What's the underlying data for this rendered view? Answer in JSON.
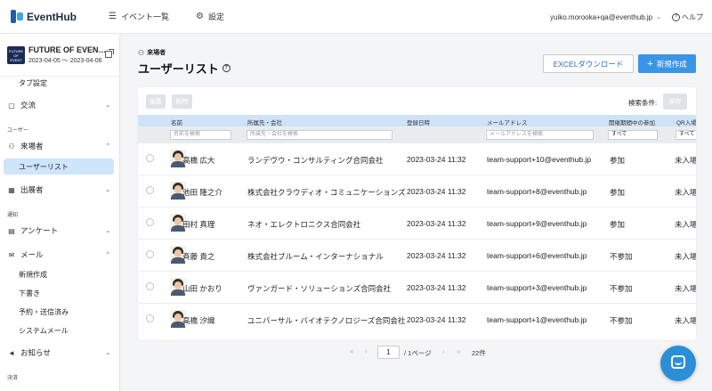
{
  "app": {
    "logo_text": "EventHub",
    "colors": {
      "accent": "#3b95e6",
      "header_row": "#cfe3f8",
      "active_nav": "#cfe5fb"
    }
  },
  "topnav": {
    "events_icon": "list-icon",
    "events_label": "イベント一覧",
    "settings_icon": "gear-icon",
    "settings_label": "設定",
    "user_email": "yuiko.morooka+qa@eventhub.jp",
    "help_label": "ヘルプ"
  },
  "sidebar": {
    "event": {
      "thumb_text": "FUTURE OF EVENT",
      "title": "FUTURE OF EVEN…",
      "dates": "2023-04-05 〜 2023-04-06"
    },
    "tab_settings": "タブ設定",
    "interaction": "交流",
    "group_user": "ユーザー",
    "attendees": "来場者",
    "user_list": "ユーザーリスト",
    "exhibitors": "出展者",
    "group_notify": "通知",
    "survey": "アンケート",
    "mail": "メール",
    "mail_new": "新規作成",
    "mail_draft": "下書き",
    "mail_scheduled": "予約・送信済み",
    "mail_system": "システムメール",
    "news": "お知らせ",
    "group_payment": "決済"
  },
  "page": {
    "crumb": "来場者",
    "title": "ユーザーリスト",
    "excel_button": "EXCELダウンロード",
    "new_button": "新規作成"
  },
  "toolbar": {
    "edit": "編集",
    "delete": "削除",
    "search_condition": "検索条件:",
    "save": "保存"
  },
  "table": {
    "columns": {
      "name": "名前",
      "company": "所属先・会社",
      "registered": "登録日時",
      "email": "メールアドレス",
      "participation": "開催期間中の参加",
      "qr": "QR入場"
    },
    "filters": {
      "name_placeholder": "名前を検索",
      "company_placeholder": "所属先・会社を検索",
      "email_placeholder": "メールアドレスを検索",
      "participation_value": "すべて",
      "qr_value": "すべて"
    },
    "rows": [
      {
        "name": "高橋 広大",
        "company": "ランデヴウ・コンサルティング合同会社",
        "registered": "2023-03-24 11:32",
        "email": "team-support+10@eventhub.jp",
        "participation": "参加",
        "qr": "未入場"
      },
      {
        "name": "池田 隆之介",
        "company": "株式会社クラウディオ・コミュニケーションズ",
        "registered": "2023-03-24 11:32",
        "email": "team-support+8@eventhub.jp",
        "participation": "参加",
        "qr": "未入場"
      },
      {
        "name": "田村 真理",
        "company": "ネオ・エレクトロニクス合同会社",
        "registered": "2023-03-24 11:32",
        "email": "team-support+9@eventhub.jp",
        "participation": "参加",
        "qr": "未入場"
      },
      {
        "name": "斉藤 貴之",
        "company": "株式会社ブルーム・インターナショナル",
        "registered": "2023-03-24 11:32",
        "email": "team-support+6@eventhub.jp",
        "participation": "不参加",
        "qr": "未入場"
      },
      {
        "name": "山田 かおり",
        "company": "ヴァンガード・ソリューションズ合同会社",
        "registered": "2023-03-24 11:32",
        "email": "team-support+3@eventhub.jp",
        "participation": "不参加",
        "qr": "未入場"
      },
      {
        "name": "高橋 汐織",
        "company": "ユニバーサル・バイオテクノロジーズ合同会社",
        "registered": "2023-03-24 11:32",
        "email": "team-support+1@eventhub.jp",
        "participation": "不参加",
        "qr": "未入場"
      }
    ]
  },
  "pagination": {
    "first": "«",
    "prev": "‹",
    "current": "1",
    "total": "/ 1ページ",
    "next": "›",
    "last": "»",
    "count": "22件"
  }
}
